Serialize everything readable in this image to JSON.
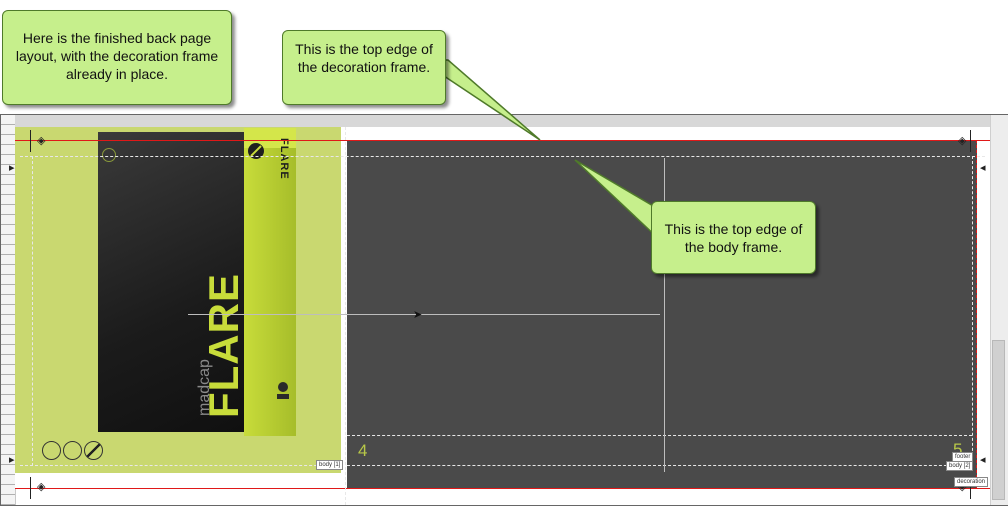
{
  "callouts": {
    "intro": "Here is the finished back page layout, with the decoration frame already in place.",
    "decoration_top": "This is the top edge of the decoration frame.",
    "body_top": "This is the top edge of the body frame."
  },
  "page": {
    "left_number": "4",
    "right_number": "5"
  },
  "frame_tags": {
    "left_body": "body [1]",
    "right_footer": "footer",
    "right_body": "body [2]",
    "right_decoration": "decoration"
  },
  "cover": {
    "brand": "madcap",
    "product": "FLARE",
    "spine_product": "FLARE"
  },
  "colors": {
    "callout_fill": "#c6ef8c",
    "frame_line": "#e01818",
    "lime_background": "#c9d870",
    "dark_page": "#4a4a4a",
    "page_number": "#b8c848"
  }
}
